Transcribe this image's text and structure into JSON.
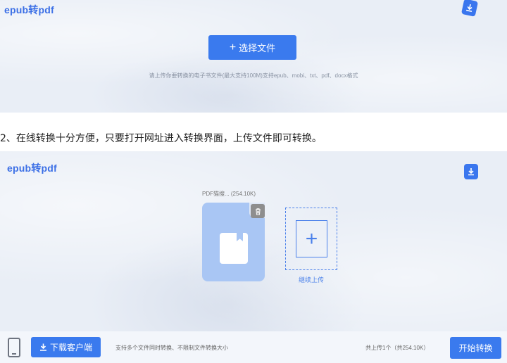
{
  "top_panel": {
    "brand": "epub转pdf",
    "select_button": {
      "plus": "+",
      "label": "选择文件"
    },
    "hint": "请上传你要转换的电子书文件(最大支持100M)支持epub、mobi、txt、pdf、docx格式"
  },
  "instruction": "2、在线转换十分方便，只要打开网址进入转换界面，上传文件即可转换。",
  "bottom_panel": {
    "brand": "epub转pdf",
    "file": {
      "name": "PDF猫搜... (254.10K)"
    },
    "continue_upload": {
      "plus": "+",
      "label": "继续上传"
    }
  },
  "bottom_bar": {
    "download_client": "下载客户端",
    "multi_file_hint": "支持多个文件同时转换、不限制文件转换大小",
    "upload_count": "共上传1个（共254.10K）",
    "start_convert": "开始转换"
  },
  "colors": {
    "accent": "#3a7aee",
    "panel_bg": "#e9eef6",
    "file_card": "#a9c6f4"
  }
}
